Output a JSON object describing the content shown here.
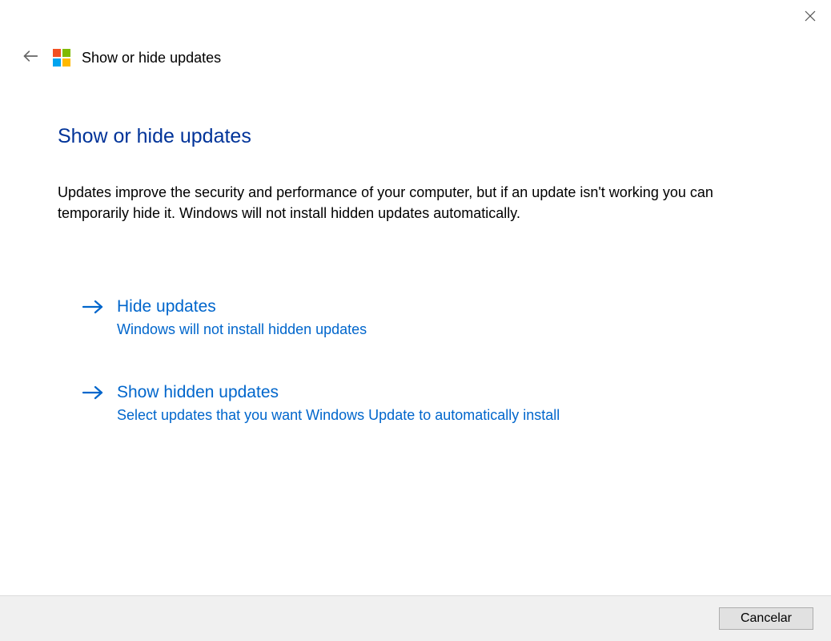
{
  "header": {
    "title": "Show or hide updates"
  },
  "main": {
    "heading": "Show or hide updates",
    "description": "Updates improve the security and performance of your computer, but if an update isn't working you can temporarily hide it. Windows will not install hidden updates automatically.",
    "options": [
      {
        "title": "Hide updates",
        "subtitle": "Windows will not install hidden updates"
      },
      {
        "title": "Show hidden updates",
        "subtitle": "Select updates that you want Windows Update to automatically install"
      }
    ]
  },
  "footer": {
    "cancel_label": "Cancelar"
  }
}
